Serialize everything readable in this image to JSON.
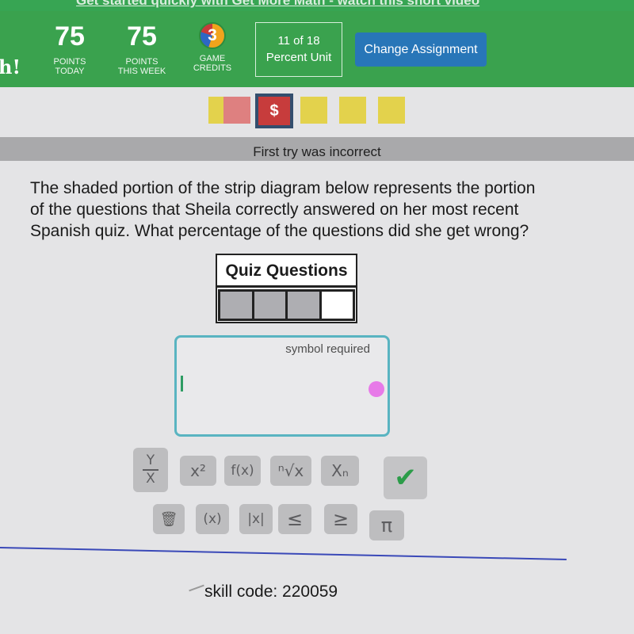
{
  "banner": {
    "link_text": "Get started quickly with Get More Math - watch this short video"
  },
  "header": {
    "brand_tail": "h!",
    "points_today": {
      "value": "75",
      "label_line1": "POINTS",
      "label_line2": "TODAY"
    },
    "points_week": {
      "value": "75",
      "label_line1": "POINTS",
      "label_line2": "THIS WEEK"
    },
    "game_credits": {
      "value": "3",
      "label_line1": "GAME",
      "label_line2": "CREDITS"
    },
    "unit": {
      "progress": "11 of 18",
      "name": "Percent Unit"
    },
    "change_assignment_label": "Change Assignment"
  },
  "progress_squares": [
    {
      "state": "correct",
      "color": "#e3d24c"
    },
    {
      "state": "incorrect",
      "color": "#de8080"
    },
    {
      "state": "current",
      "symbol": "$",
      "color": "#c73c3c"
    },
    {
      "state": "correct",
      "color": "#e3d24c"
    },
    {
      "state": "correct",
      "color": "#e3d24c"
    },
    {
      "state": "correct",
      "color": "#e3d24c"
    }
  ],
  "feedback": "First try was incorrect",
  "question": {
    "line1": "The shaded portion of the strip diagram below represents the portion",
    "line2": "of the questions that Sheila correctly answered on her most recent",
    "line3": "Spanish quiz. What percentage of the questions did she get wrong?"
  },
  "strip_diagram": {
    "title": "Quiz Questions",
    "total_parts": 4,
    "shaded_parts": 3
  },
  "answer_box": {
    "hint": "symbol required",
    "value": ""
  },
  "keypad": {
    "row1": [
      {
        "name": "fraction-key",
        "top": "Y",
        "bottom": "X"
      },
      {
        "name": "exponent-key",
        "label": "x²"
      },
      {
        "name": "function-key",
        "label": "f(x)"
      },
      {
        "name": "nth-root-key",
        "label": "ⁿ√x"
      },
      {
        "name": "subscript-key",
        "label": "Xₙ"
      },
      {
        "name": "submit-check-key",
        "label": "✔"
      }
    ],
    "row2": [
      {
        "name": "delete-key",
        "label": "🗑"
      },
      {
        "name": "parentheses-key",
        "label": "(x)"
      },
      {
        "name": "absolute-value-key",
        "label": "|x|"
      },
      {
        "name": "less-equal-key",
        "label": "≤"
      },
      {
        "name": "greater-equal-key",
        "label": "≥"
      },
      {
        "name": "pi-key",
        "label": "π"
      }
    ]
  },
  "footer": {
    "skill_code": "skill code: 220059"
  }
}
